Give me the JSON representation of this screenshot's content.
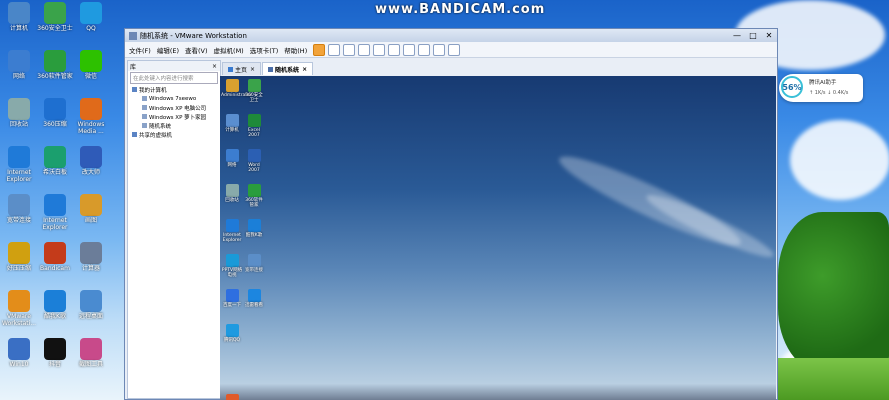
{
  "watermark": "www.BANDICAM.com",
  "desktop_icons": [
    {
      "label": "计算机",
      "color": "#4a86c8",
      "x": 0,
      "y": 0
    },
    {
      "label": "360安全卫士",
      "color": "#3aa34a",
      "x": 1,
      "y": 0
    },
    {
      "label": "QQ",
      "color": "#1f9ae0",
      "x": 2,
      "y": 0
    },
    {
      "label": "网络",
      "color": "#3c7dd0",
      "x": 0,
      "y": 1
    },
    {
      "label": "360软件管家",
      "color": "#2a9d3d",
      "x": 1,
      "y": 1
    },
    {
      "label": "微信",
      "color": "#2dc100",
      "x": 2,
      "y": 1
    },
    {
      "label": "回收站",
      "color": "#8aa",
      "x": 0,
      "y": 2
    },
    {
      "label": "360压缩",
      "color": "#1e6fd0",
      "x": 1,
      "y": 2
    },
    {
      "label": "Windows Media ...",
      "color": "#e06a1a",
      "x": 2,
      "y": 2
    },
    {
      "label": "Internet Explorer",
      "color": "#1f7ad8",
      "x": 0,
      "y": 3
    },
    {
      "label": "希沃白板",
      "color": "#1b9f6e",
      "x": 1,
      "y": 3
    },
    {
      "label": "改大师",
      "color": "#2f5bb8",
      "x": 2,
      "y": 3
    },
    {
      "label": "宽带连接",
      "color": "#5b8ec8",
      "x": 0,
      "y": 4
    },
    {
      "label": "Internet Explorer",
      "color": "#1f7ad8",
      "x": 1,
      "y": 4
    },
    {
      "label": "画图",
      "color": "#d89a2a",
      "x": 2,
      "y": 4
    },
    {
      "label": "好压压缩",
      "color": "#d0a010",
      "x": 0,
      "y": 5
    },
    {
      "label": "Bandicam",
      "color": "#c43b1a",
      "x": 1,
      "y": 5
    },
    {
      "label": "计算器",
      "color": "#6b7d99",
      "x": 2,
      "y": 5
    },
    {
      "label": "VMware Workstati...",
      "color": "#e38d1a",
      "x": 0,
      "y": 6
    },
    {
      "label": "酷我K歌",
      "color": "#1b7fd8",
      "x": 1,
      "y": 6
    },
    {
      "label": "远程桌面",
      "color": "#4a8bd0",
      "x": 2,
      "y": 6
    },
    {
      "label": "Win10",
      "color": "#3a6fc4",
      "x": 0,
      "y": 7
    },
    {
      "label": "抖音",
      "color": "#111",
      "x": 1,
      "y": 7
    },
    {
      "label": "截图工具",
      "color": "#c84a8a",
      "x": 2,
      "y": 7
    }
  ],
  "vmware": {
    "title": "随机系统 - VMware Workstation",
    "controls": [
      "—",
      "□",
      "✕"
    ],
    "menu": [
      "文件(F)",
      "编辑(E)",
      "查看(V)",
      "虚拟机(M)",
      "选项卡(T)",
      "帮助(H)"
    ],
    "library": {
      "header": "库",
      "close": "×",
      "search_placeholder": "在此处键入内容进行搜索",
      "tree": [
        {
          "label": "我的计算机",
          "level": 0
        },
        {
          "label": "Windows 7seewo",
          "level": 1
        },
        {
          "label": "Windows XP 电脑公司",
          "level": 1
        },
        {
          "label": "Windows XP 萝卜家园",
          "level": 1
        },
        {
          "label": "随机系统",
          "level": 1
        },
        {
          "label": "共享的虚拟机",
          "level": 0
        }
      ]
    },
    "tabs": [
      {
        "label": "主页",
        "active": false
      },
      {
        "label": "随机系统",
        "active": true
      }
    ],
    "vm_icons": [
      {
        "label": "Administrator",
        "color": "#d8a030",
        "col": 0,
        "row": 0
      },
      {
        "label": "360安全卫士",
        "color": "#3aa34a",
        "col": 1,
        "row": 0
      },
      {
        "label": "计算机",
        "color": "#5a8ed0",
        "col": 0,
        "row": 1
      },
      {
        "label": "Excel 2007",
        "color": "#1e8a3a",
        "col": 1,
        "row": 1
      },
      {
        "label": "网络",
        "color": "#3c7dd0",
        "col": 0,
        "row": 2
      },
      {
        "label": "Word 2007",
        "color": "#2b5fb3",
        "col": 1,
        "row": 2
      },
      {
        "label": "回收站",
        "color": "#8aa",
        "col": 0,
        "row": 3
      },
      {
        "label": "360软件管家",
        "color": "#2a9d3d",
        "col": 1,
        "row": 3
      },
      {
        "label": "Internet Explorer",
        "color": "#1f7ad8",
        "col": 0,
        "row": 4
      },
      {
        "label": "酷我K歌",
        "color": "#1b7fd8",
        "col": 1,
        "row": 4
      },
      {
        "label": "PPTV网络电视",
        "color": "#1a9ad8",
        "col": 0,
        "row": 5
      },
      {
        "label": "宽带连接",
        "color": "#5b8ec8",
        "col": 1,
        "row": 5
      },
      {
        "label": "百度一下",
        "color": "#2e6fe0",
        "col": 0,
        "row": 6
      },
      {
        "label": "迅雷看看",
        "color": "#1c86e0",
        "col": 1,
        "row": 6
      },
      {
        "label": "腾讯QQ",
        "color": "#1f9ae0",
        "col": 0,
        "row": 7
      },
      {
        "label": "搜狗输入法",
        "color": "#e05a2a",
        "col": 0,
        "row": 9
      }
    ]
  },
  "widget": {
    "percent": "56%",
    "title": "腾讯AI助手",
    "stats": "↑ 1K/s    ↓ 0.4K/s"
  }
}
